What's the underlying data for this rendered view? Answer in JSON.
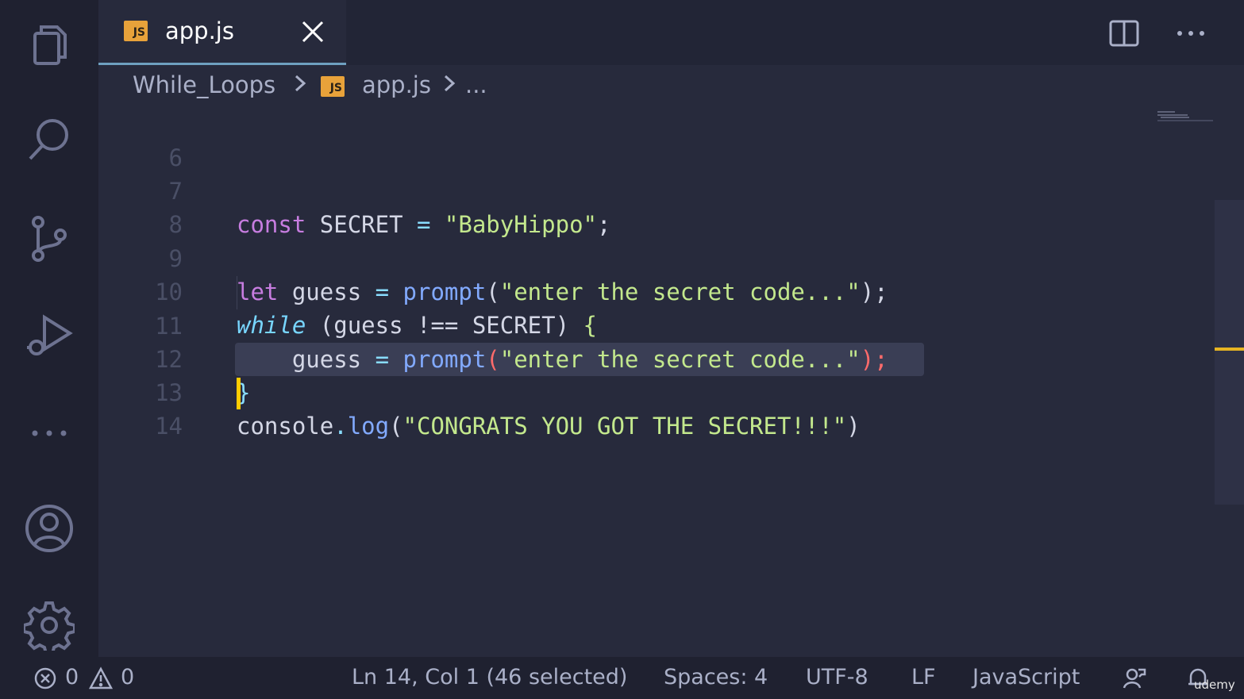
{
  "tab": {
    "file_label": "app.js",
    "badge": "JS"
  },
  "breadcrumb": {
    "folder": "While_Loops",
    "file": "app.js",
    "more": "...",
    "badge": "JS"
  },
  "editor": {
    "lines": [
      {
        "num": "6"
      },
      {
        "num": "7"
      },
      {
        "num": "8"
      },
      {
        "num": "9"
      },
      {
        "num": "10"
      },
      {
        "num": "11"
      },
      {
        "num": "12"
      },
      {
        "num": "13"
      },
      {
        "num": "14"
      }
    ],
    "code": {
      "l7": {
        "kw": "const",
        "name": " SECRET ",
        "op": "=",
        "str": " \"BabyHippo\"",
        "end": ";"
      },
      "l9": {
        "kw": "let",
        "name": " guess ",
        "op": "=",
        "fn": " prompt",
        "open": "(",
        "str": "\"enter the secret code...\"",
        "end": ");"
      },
      "l10": {
        "kw": "while",
        "rest": " (guess !== SECRET) ",
        "brace": "{"
      },
      "l11": {
        "name": "    guess ",
        "op": "=",
        "fn": " prompt",
        "open": "(",
        "str": "\"enter the secret code...\"",
        "end": ");"
      },
      "l12": {
        "brace": "}"
      },
      "l13": {
        "obj": "console",
        "dot": ".",
        "fn": "log",
        "open": "(",
        "str": "\"CONGRATS YOU GOT THE SECRET!!!\"",
        "end": ")"
      }
    },
    "selected_text": "console.log(\"CONGRATS YOU GOT THE SECRET!!!\")"
  },
  "statusbar": {
    "errors": "0",
    "warnings": "0",
    "position": "Ln 14, Col 1 (46 selected)",
    "spaces": "Spaces: 4",
    "encoding": "UTF-8",
    "eol": "LF",
    "language": "JavaScript",
    "watermark": "udemy"
  },
  "icons": {
    "activity": [
      "files-icon",
      "search-icon",
      "source-control-icon",
      "run-debug-icon",
      "more-icon",
      "account-icon",
      "settings-gear-icon"
    ]
  },
  "colors": {
    "background": "#272a3c",
    "activity_bar": "#1f2130",
    "keyword": "#c77de0",
    "italic_keyword": "#78d6ff",
    "function": "#82aaff",
    "string": "#c3e88d",
    "punctuation": "#89ddff",
    "cursor": "#ffcc00",
    "js_badge": "#e8a23a"
  }
}
